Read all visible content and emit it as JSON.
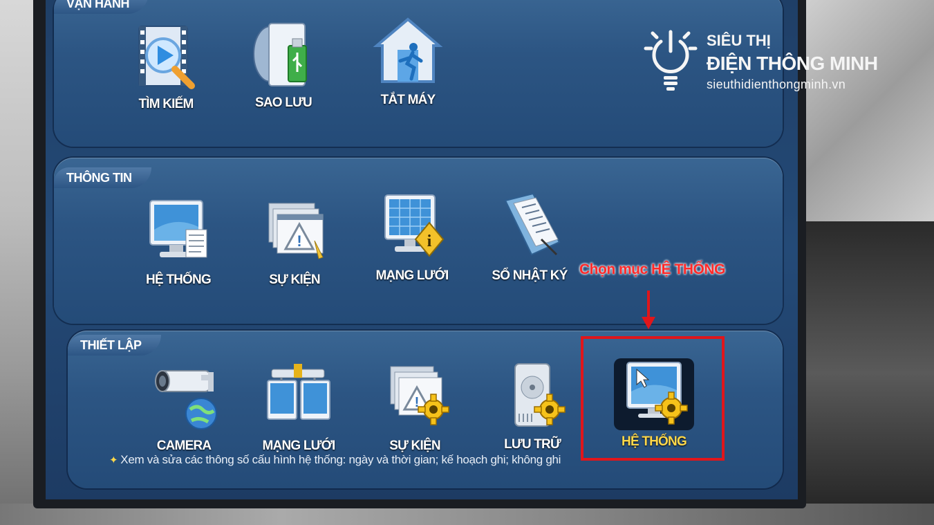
{
  "sections": [
    {
      "title": "VẬN HÀNH",
      "items": [
        {
          "label": "TÌM KIẾM",
          "icon": "search-video-icon"
        },
        {
          "label": "SAO LƯU",
          "icon": "backup-usb-icon"
        },
        {
          "label": "TẮT MÁY",
          "icon": "shutdown-exit-icon"
        }
      ]
    },
    {
      "title": "THÔNG TIN",
      "items": [
        {
          "label": "HỆ THỐNG",
          "icon": "system-info-monitor-icon"
        },
        {
          "label": "SỰ KIỆN",
          "icon": "event-warning-icon"
        },
        {
          "label": "MẠNG LƯỚI",
          "icon": "network-info-icon"
        },
        {
          "label": "SỔ NHẬT KÝ",
          "icon": "log-book-icon"
        }
      ]
    },
    {
      "title": "THIẾT LẬP",
      "items": [
        {
          "label": "CAMERA",
          "icon": "camera-icon"
        },
        {
          "label": "MẠNG LƯỚI",
          "icon": "network-setup-icon"
        },
        {
          "label": "SỰ KIỆN",
          "icon": "event-setup-icon"
        },
        {
          "label": "LƯU TRỮ",
          "icon": "storage-setup-icon"
        },
        {
          "label": "HỆ THỐNG",
          "icon": "system-setup-icon",
          "selected": true
        }
      ]
    }
  ],
  "hint": "Xem và sửa các thông số cấu hình hệ thống: ngày và thời gian; kế hoạch ghi; không ghi",
  "annotation": "Chọn mục HỆ THỐNG",
  "watermark": {
    "line1": "SIÊU THỊ",
    "line2": "ĐIỆN THÔNG MINH",
    "line3": "sieuthidienthongminh.vn"
  },
  "colors": {
    "panel": "#2c5583",
    "annotation": "#e0161b",
    "selected_label": "#ffd84a",
    "gear": "#f6c21a"
  }
}
